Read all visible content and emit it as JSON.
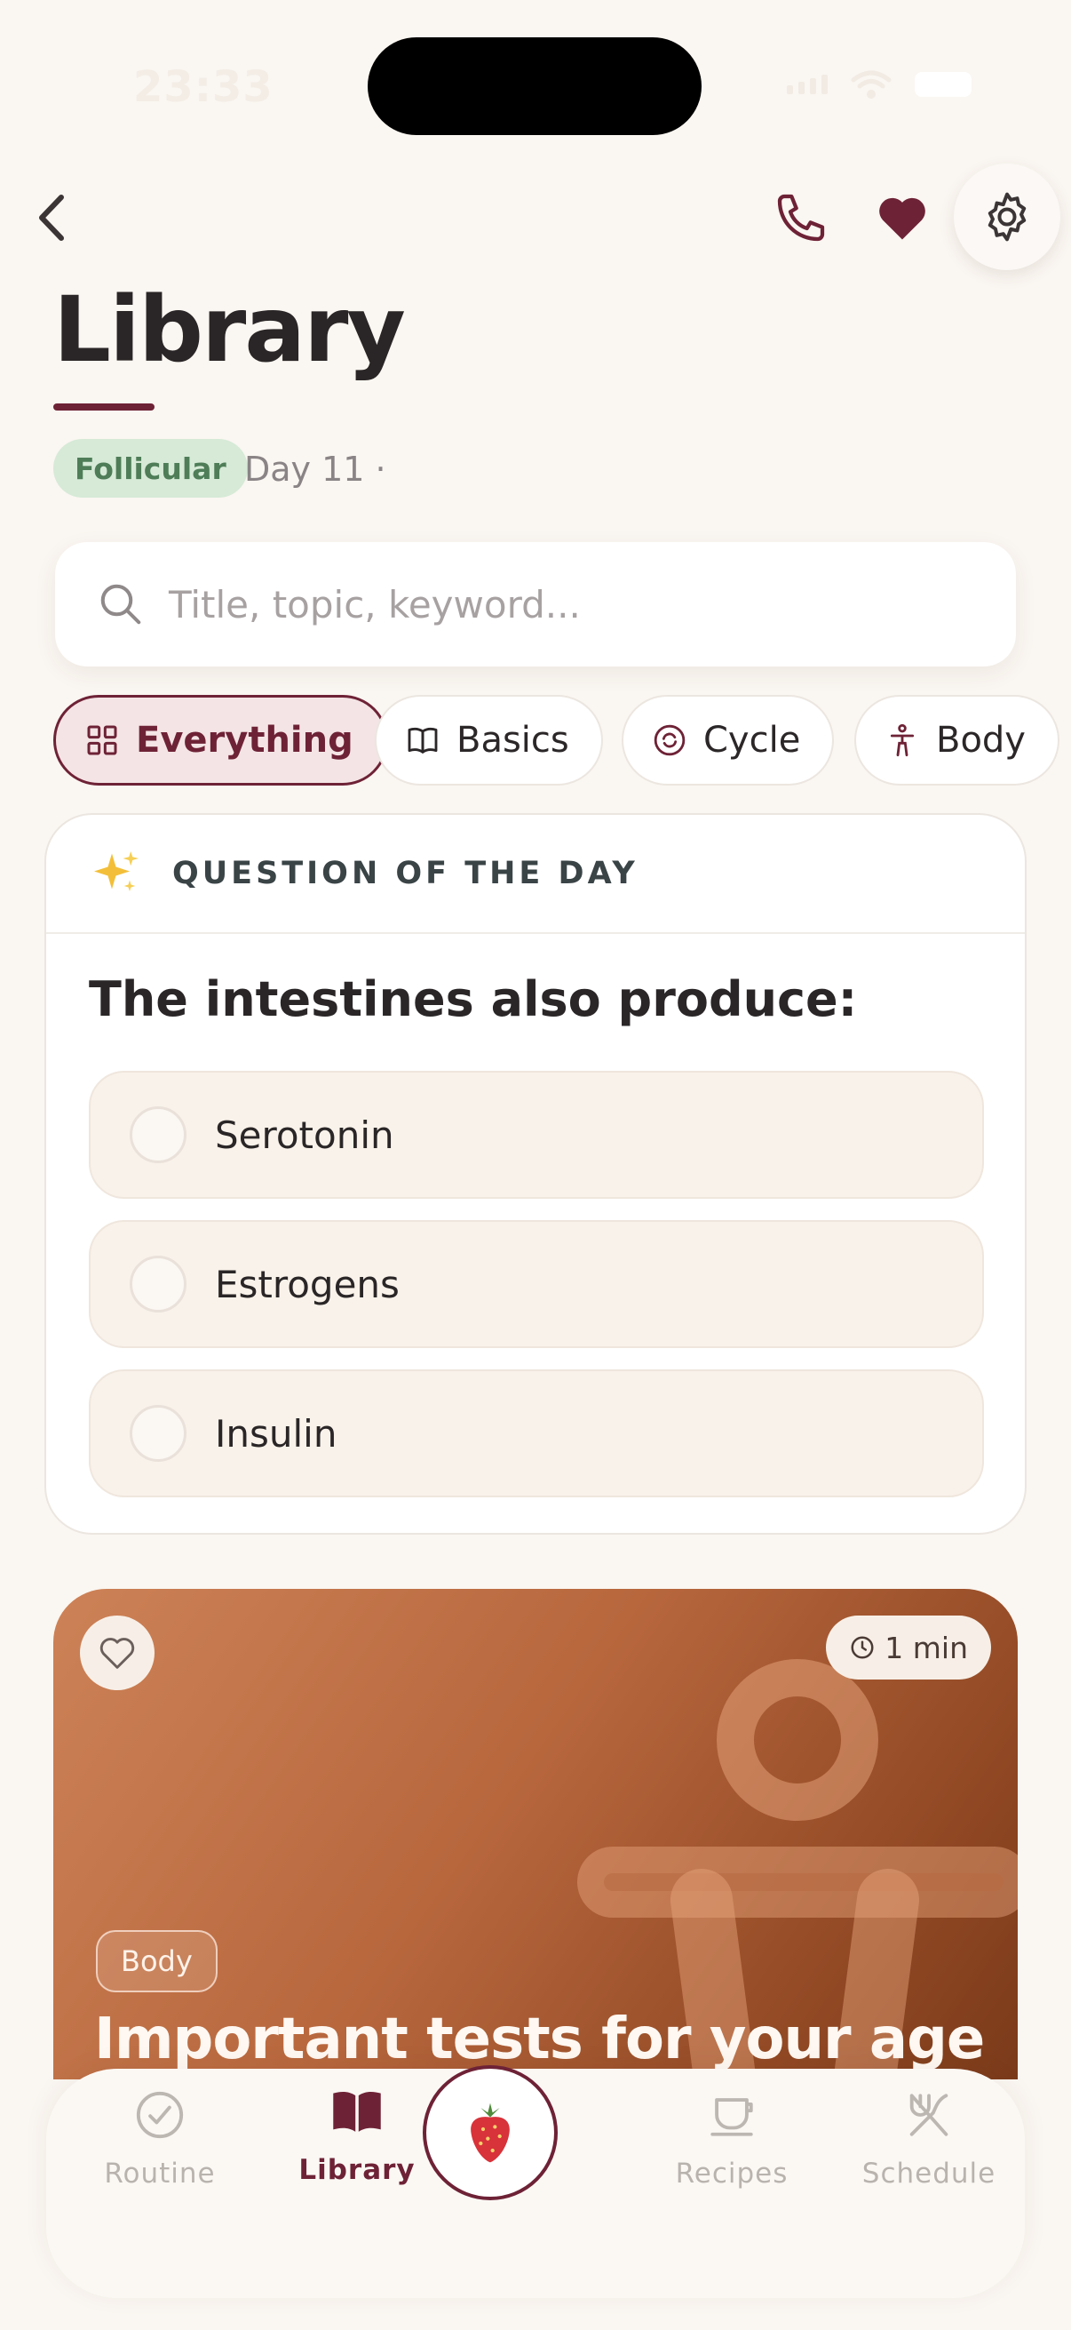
{
  "status_bar": {
    "time": "23:33"
  },
  "header": {
    "title": "Library"
  },
  "cycle": {
    "phase": "Follicular",
    "day": "Day 11 ·"
  },
  "search": {
    "placeholder": "Title, topic, keyword..."
  },
  "filters": [
    {
      "label": "Everything",
      "icon": "grid-icon",
      "active": true
    },
    {
      "label": "Basics",
      "icon": "book-open-icon",
      "active": false
    },
    {
      "label": "Cycle",
      "icon": "cycle-icon",
      "active": false
    },
    {
      "label": "Body",
      "icon": "body-icon",
      "active": false
    }
  ],
  "question": {
    "header": "QUESTION OF THE DAY",
    "text": "The intestines also produce:",
    "options": [
      "Serotonin",
      "Estrogens",
      "Insulin"
    ]
  },
  "article": {
    "duration": "1 min",
    "category": "Body",
    "title": "Important tests for your age"
  },
  "nav": {
    "items": [
      {
        "label": "Routine",
        "icon": "check-circle-icon",
        "active": false
      },
      {
        "label": "Library",
        "icon": "book-icon",
        "active": true
      },
      {
        "label": "Recipes",
        "icon": "cup-icon",
        "active": false
      },
      {
        "label": "Schedule",
        "icon": "utensils-icon",
        "active": false
      }
    ],
    "center": {
      "icon": "strawberry-icon"
    }
  },
  "colors": {
    "accent": "#6e2236",
    "background": "#faf6f1",
    "phase_badge": "#d6ead7"
  }
}
